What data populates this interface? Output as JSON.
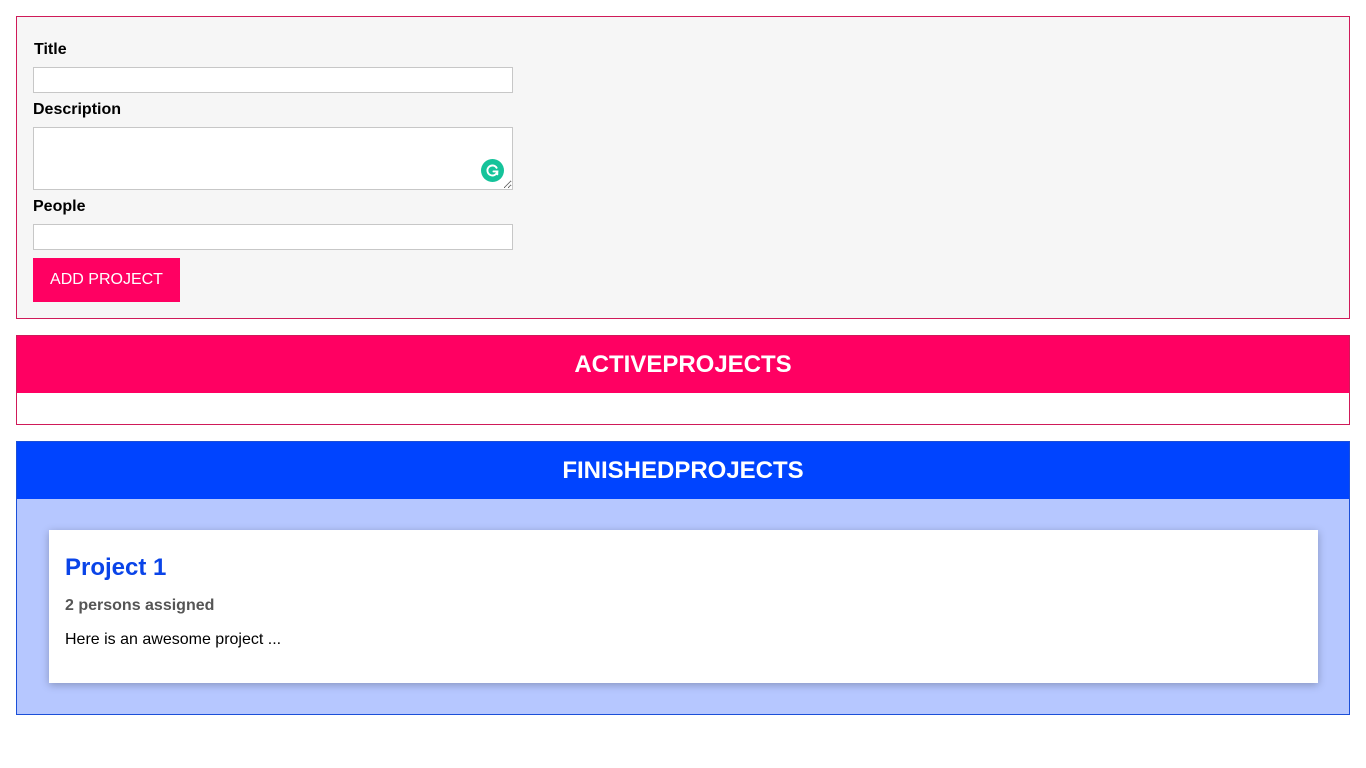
{
  "form": {
    "title_label": "Title",
    "title_value": "",
    "description_label": "Description",
    "description_value": "",
    "people_label": "People",
    "people_value": "",
    "submit_label": "ADD PROJECT",
    "grammarly_icon": "grammarly-icon"
  },
  "active_projects": {
    "heading": "ACTIVEPROJECTS",
    "items": []
  },
  "finished_projects": {
    "heading": "FINISHEDPROJECTS",
    "items": [
      {
        "title": "Project 1",
        "people": "2 persons assigned",
        "description": "Here is an awesome project ..."
      }
    ]
  },
  "colors": {
    "active_accent": "#ff0062",
    "finished_accent": "#0044ff",
    "finished_list_bg": "#b6c7ff",
    "form_bg": "#f6f6f6",
    "grammarly": "#15c39a"
  }
}
